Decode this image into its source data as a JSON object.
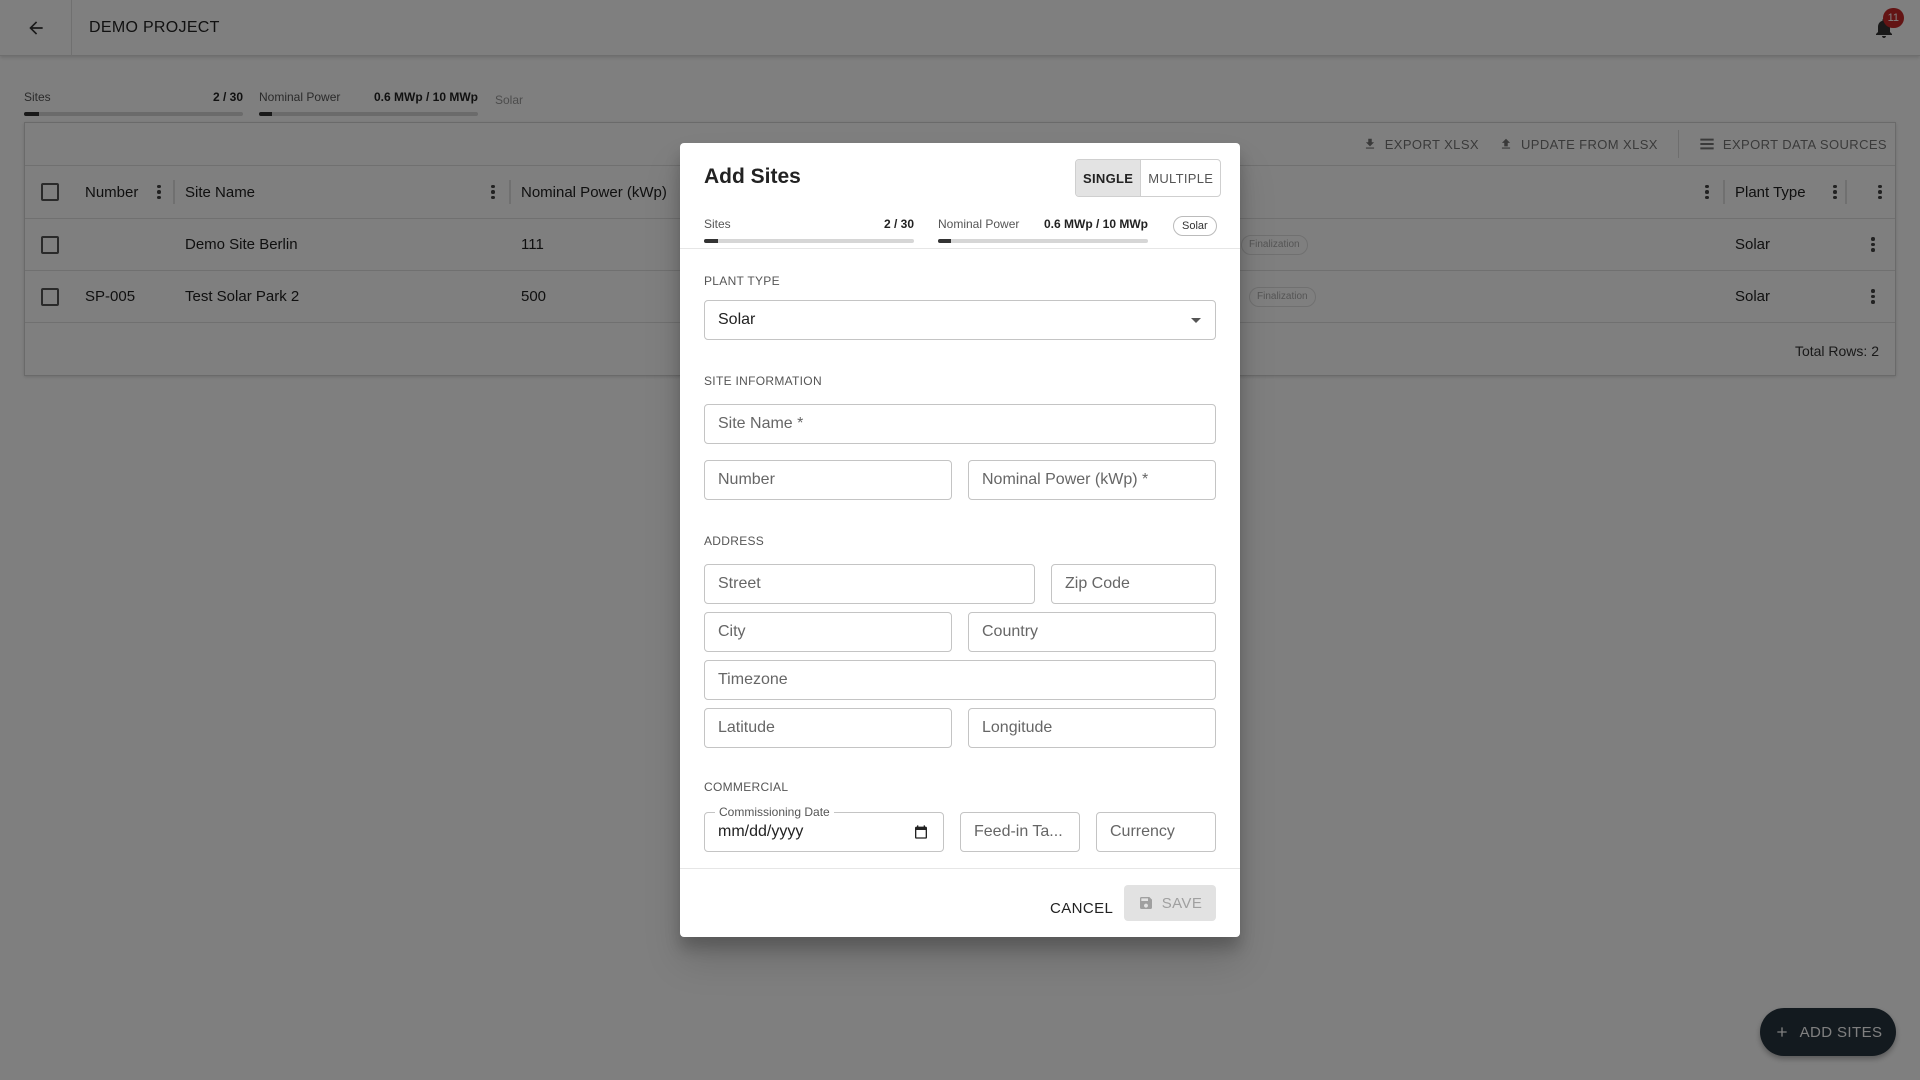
{
  "app": {
    "title": "DEMO PROJECT",
    "notification_count": "11"
  },
  "stats": {
    "sites_label": "Sites",
    "sites_value": "2 / 30",
    "sites_fraction": 0.0667,
    "power_label": "Nominal Power",
    "power_value": "0.6 MWp / 10 MWp",
    "power_fraction": 0.06,
    "plant_type": "Solar"
  },
  "toolbar": {
    "export_xlsx": "EXPORT XLSX",
    "update_xlsx": "UPDATE FROM XLSX",
    "export_sources": "EXPORT DATA SOURCES"
  },
  "table": {
    "headers": {
      "number": "Number",
      "site_name": "Site Name",
      "nominal_power": "Nominal Power (kWp)",
      "plant_type": "Plant Type"
    },
    "rows": [
      {
        "number": "",
        "site_name": "Demo Site Berlin",
        "nominal_power": "111",
        "status": "Finalization",
        "plant_type": "Solar"
      },
      {
        "number": "SP-005",
        "site_name": "Test Solar Park 2",
        "nominal_power": "500",
        "status": "Finalization",
        "plant_type": "Solar"
      }
    ],
    "total_rows": "Total Rows: 2"
  },
  "fab": {
    "label": "ADD SITES"
  },
  "dialog": {
    "title": "Add Sites",
    "mode_single": "SINGLE",
    "mode_multiple": "MULTIPLE",
    "stats": {
      "sites_label": "Sites",
      "sites_value": "2 / 30",
      "sites_fraction": 0.0667,
      "power_label": "Nominal Power",
      "power_value": "0.6 MWp / 10 MWp",
      "power_fraction": 0.06,
      "plant_type": "Solar"
    },
    "plant_type_section": "PLANT TYPE",
    "plant_type_value": "Solar",
    "site_info_section": "SITE INFORMATION",
    "site_name_placeholder": "Site Name *",
    "number_placeholder": "Number",
    "nominal_power_placeholder": "Nominal Power (kWp) *",
    "address_section": "ADDRESS",
    "street_placeholder": "Street",
    "zip_placeholder": "Zip Code",
    "city_placeholder": "City",
    "country_placeholder": "Country",
    "timezone_placeholder": "Timezone",
    "latitude_placeholder": "Latitude",
    "longitude_placeholder": "Longitude",
    "commercial_section": "COMMERCIAL",
    "commissioning_label": "Commissioning Date",
    "commissioning_value": "mm/dd/yyyy",
    "feed_in_placeholder": "Feed-in Ta...",
    "currency_placeholder": "Currency",
    "cancel_label": "CANCEL",
    "save_label": "SAVE"
  }
}
